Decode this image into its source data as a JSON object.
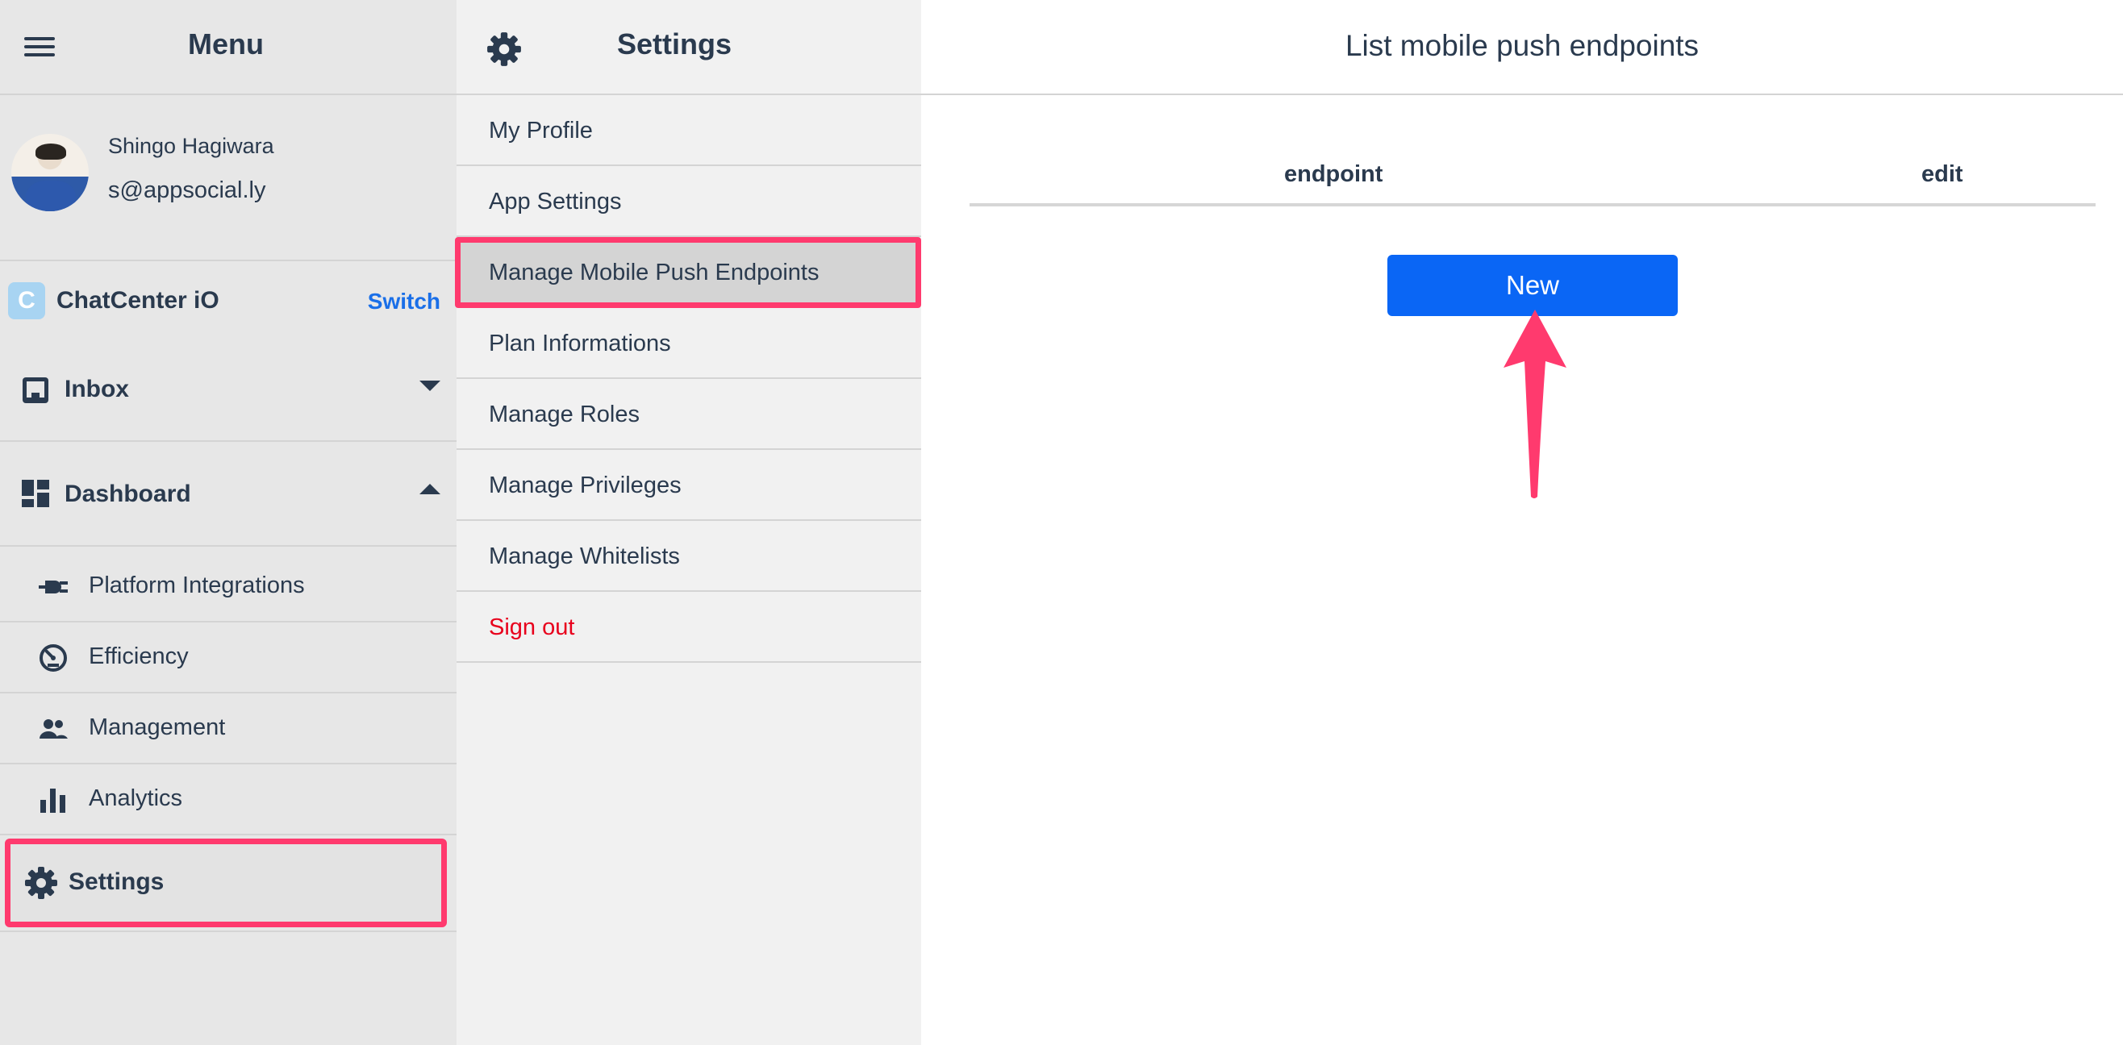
{
  "menu": {
    "title": "Menu",
    "user": {
      "name": "Shingo Hagiwara",
      "email": "s@appsocial.ly"
    },
    "org": {
      "logo_letter": "C",
      "name": "ChatCenter iO",
      "switch_label": "Switch"
    },
    "groups": [
      {
        "label": "Inbox",
        "icon": "inbox-icon",
        "expanded": false
      },
      {
        "label": "Dashboard",
        "icon": "dashboard-icon",
        "expanded": true
      }
    ],
    "dashboard_items": [
      {
        "label": "Platform Integrations",
        "icon": "plug-icon"
      },
      {
        "label": "Efficiency",
        "icon": "speedometer-icon"
      },
      {
        "label": "Management",
        "icon": "people-icon"
      },
      {
        "label": "Analytics",
        "icon": "bar-chart-icon"
      }
    ],
    "settings_label": "Settings"
  },
  "settings_panel": {
    "title": "Settings",
    "items": [
      {
        "label": "My Profile"
      },
      {
        "label": "App Settings"
      },
      {
        "label": "Manage Mobile Push Endpoints",
        "active": true
      },
      {
        "label": "Plan Informations"
      },
      {
        "label": "Manage Roles"
      },
      {
        "label": "Manage Privileges"
      },
      {
        "label": "Manage Whitelists"
      },
      {
        "label": "Sign out"
      }
    ]
  },
  "main": {
    "title": "List mobile push endpoints",
    "columns": [
      "endpoint",
      "edit"
    ],
    "new_button_label": "New"
  },
  "colors": {
    "highlight": "#ff3a6e",
    "primary_button": "#0a66f5",
    "link": "#1a6fe8",
    "sign_out": "#e8001c",
    "text": "#2a3a4e"
  }
}
